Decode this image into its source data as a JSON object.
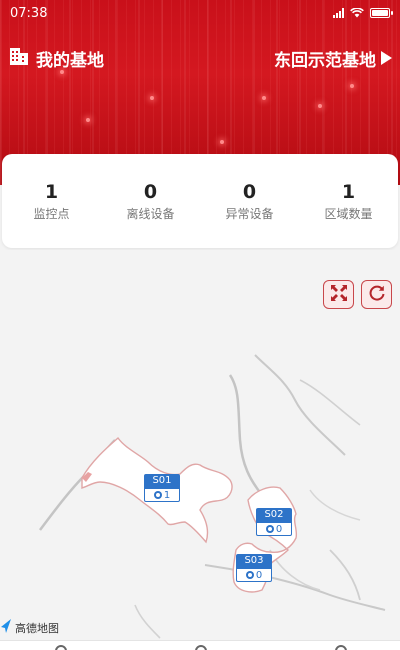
{
  "status_bar": {
    "time": "07:38"
  },
  "header": {
    "title": "我的基地",
    "base_name": "东回示范基地",
    "accent": "#d41820"
  },
  "stats": [
    {
      "value": "1",
      "label": "监控点"
    },
    {
      "value": "0",
      "label": "离线设备"
    },
    {
      "value": "0",
      "label": "异常设备"
    },
    {
      "value": "1",
      "label": "区域数量"
    }
  ],
  "map": {
    "provider": "高德地图",
    "buttons": {
      "fullscreen_icon": "fullscreen-icon",
      "refresh_icon": "refresh-icon"
    },
    "markers": [
      {
        "code": "S01",
        "count": "1"
      },
      {
        "code": "S02",
        "count": "0"
      },
      {
        "code": "S03",
        "count": "0"
      }
    ],
    "marker_color": "#2d73c8"
  }
}
